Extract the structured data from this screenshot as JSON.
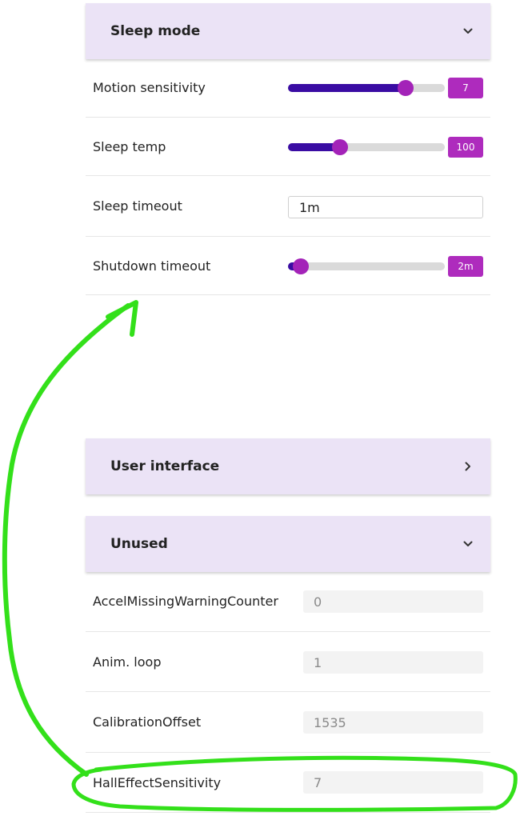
{
  "sleep_mode": {
    "title": "Sleep mode",
    "rows": [
      {
        "label": "Motion sensitivity",
        "value": "7",
        "fraction": 0.75
      },
      {
        "label": "Sleep temp",
        "value": "100",
        "fraction": 0.33
      },
      {
        "label": "Sleep timeout",
        "value": "1m"
      },
      {
        "label": "Shutdown timeout",
        "value": "2m",
        "fraction": 0.08
      }
    ]
  },
  "user_interface": {
    "title": "User interface"
  },
  "unused": {
    "title": "Unused",
    "rows": [
      {
        "label": "AccelMissingWarningCounter",
        "value": "0"
      },
      {
        "label": "Anim. loop",
        "value": "1"
      },
      {
        "label": "CalibrationOffset",
        "value": "1535"
      },
      {
        "label": "HallEffectSensitivity",
        "value": "7"
      }
    ]
  },
  "colors": {
    "header_bg": "#ebe3f6",
    "slider_fill": "#3a0ca3",
    "slider_thumb": "#a323b8",
    "badge_bg": "#ae2bbd",
    "annotation": "#33e01a"
  },
  "icons": {
    "expanded": "chevron-down-icon",
    "collapsed": "chevron-right-icon"
  }
}
